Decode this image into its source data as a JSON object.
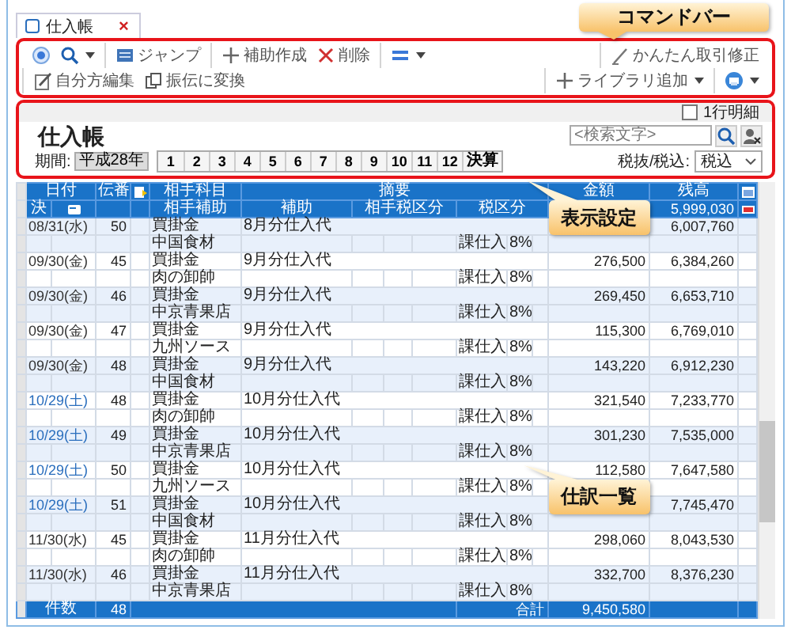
{
  "tab": {
    "label": "仕入帳",
    "close": "×"
  },
  "toolbar": {
    "groups": [
      [
        {
          "dropdown": false
        },
        {
          "dropdown": true
        }
      ],
      [
        {
          "label": "ジャンプ",
          "dropdown": false
        }
      ],
      [
        {
          "label": "補助作成",
          "dropdown": false
        },
        {
          "label": "削除",
          "dropdown": false
        }
      ],
      [
        {
          "dropdown": true
        }
      ],
      [
        {
          "label": "かんたん取引修正",
          "dropdown": false
        }
      ],
      [
        {
          "label": "自分方編集",
          "dropdown": false
        },
        {
          "label": "振伝に変換",
          "dropdown": false
        }
      ],
      [
        {
          "label": "ライブラリ追加",
          "dropdown": true
        }
      ],
      [
        {
          "dropdown": true
        }
      ]
    ]
  },
  "settings": {
    "row_detail": {
      "label": "1行明細",
      "checked": false
    },
    "title": "仕入帳",
    "search": {
      "placeholder": "<検索文字>"
    },
    "period": {
      "label": "期間:",
      "era": "平成28年",
      "buttons": [
        "1",
        "2",
        "3",
        "4",
        "5",
        "6",
        "7",
        "8",
        "9",
        "10",
        "11",
        "12",
        "決算"
      ]
    },
    "tax_mode": {
      "label": "税抜/税込:",
      "value": "税込"
    }
  },
  "table": {
    "header": {
      "date": "日付",
      "number": "伝番",
      "account": "相手科目",
      "summary": "摘要",
      "amount": "金額",
      "balance": "残高",
      "settle": "決",
      "partner_sub": "相手補助",
      "sub": "補助",
      "partner_tax": "相手税区分",
      "tax": "税区分",
      "opening_balance": "5,999,030"
    },
    "entries": [
      {
        "date": "08/31(水)",
        "color": "#333333",
        "number": "50",
        "account": "買掛金",
        "description": "8月分仕入代",
        "balance": "6,007,760",
        "vendor": "中国食材",
        "tax_type": "課仕入",
        "tax_rate": "8%"
      },
      {
        "date": "09/30(金)",
        "color": "#333333",
        "number": "45",
        "account": "買掛金",
        "description": "9月分仕入代",
        "amount": "276,500",
        "balance": "6,384,260",
        "vendor": "肉の卸帥",
        "tax_type": "課仕入",
        "tax_rate": "8%"
      },
      {
        "date": "09/30(金)",
        "color": "#333333",
        "number": "46",
        "account": "買掛金",
        "description": "9月分仕入代",
        "amount": "269,450",
        "balance": "6,653,710",
        "vendor": "中京青果店",
        "tax_type": "課仕入",
        "tax_rate": "8%"
      },
      {
        "date": "09/30(金)",
        "color": "#333333",
        "number": "47",
        "account": "買掛金",
        "description": "9月分仕入代",
        "amount": "115,300",
        "balance": "6,769,010",
        "vendor": "九州ソース",
        "tax_type": "課仕入",
        "tax_rate": "8%"
      },
      {
        "date": "09/30(金)",
        "color": "#333333",
        "number": "48",
        "account": "買掛金",
        "description": "9月分仕入代",
        "amount": "143,220",
        "balance": "6,912,230",
        "vendor": "中国食材",
        "tax_type": "課仕入",
        "tax_rate": "8%"
      },
      {
        "date": "10/29(土)",
        "color": "#2a6ebd",
        "number": "48",
        "account": "買掛金",
        "description": "10月分仕入代",
        "amount": "321,540",
        "balance": "7,233,770",
        "vendor": "肉の卸帥",
        "tax_type": "課仕入",
        "tax_rate": "8%"
      },
      {
        "date": "10/29(土)",
        "color": "#2a6ebd",
        "number": "49",
        "account": "買掛金",
        "description": "10月分仕入代",
        "amount": "301,230",
        "balance": "7,535,000",
        "vendor": "中京青果店",
        "tax_type": "課仕入",
        "tax_rate": "8%"
      },
      {
        "date": "10/29(土)",
        "color": "#2a6ebd",
        "number": "50",
        "account": "買掛金",
        "description": "10月分仕入代",
        "amount": "112,580",
        "balance": "7,647,580",
        "vendor": "九州ソース",
        "tax_type": "課仕入",
        "tax_rate": "8%"
      },
      {
        "date": "10/29(土)",
        "color": "#2a6ebd",
        "number": "51",
        "account": "買掛金",
        "description": "10月分仕入代",
        "balance": "7,745,470",
        "vendor": "中国食材",
        "tax_type": "課仕入",
        "tax_rate": "8%"
      },
      {
        "date": "11/30(水)",
        "color": "#333333",
        "number": "45",
        "account": "買掛金",
        "description": "11月分仕入代",
        "amount": "298,060",
        "balance": "8,043,530",
        "vendor": "肉の卸帥",
        "tax_type": "課仕入",
        "tax_rate": "8%"
      },
      {
        "date": "11/30(水)",
        "color": "#333333",
        "number": "46",
        "account": "買掛金",
        "description": "11月分仕入代",
        "amount": "332,700",
        "balance": "8,376,230",
        "vendor": "中京青果店",
        "tax_type": "課仕入",
        "tax_rate": "8%"
      }
    ],
    "footer": {
      "count_label": "件数",
      "count": "48",
      "total_label": "合計",
      "total": "9,450,580"
    }
  },
  "callouts": [
    {
      "text": "コマンドバー"
    },
    {
      "text": "表示設定"
    },
    {
      "text": "仕訳一覧"
    }
  ]
}
